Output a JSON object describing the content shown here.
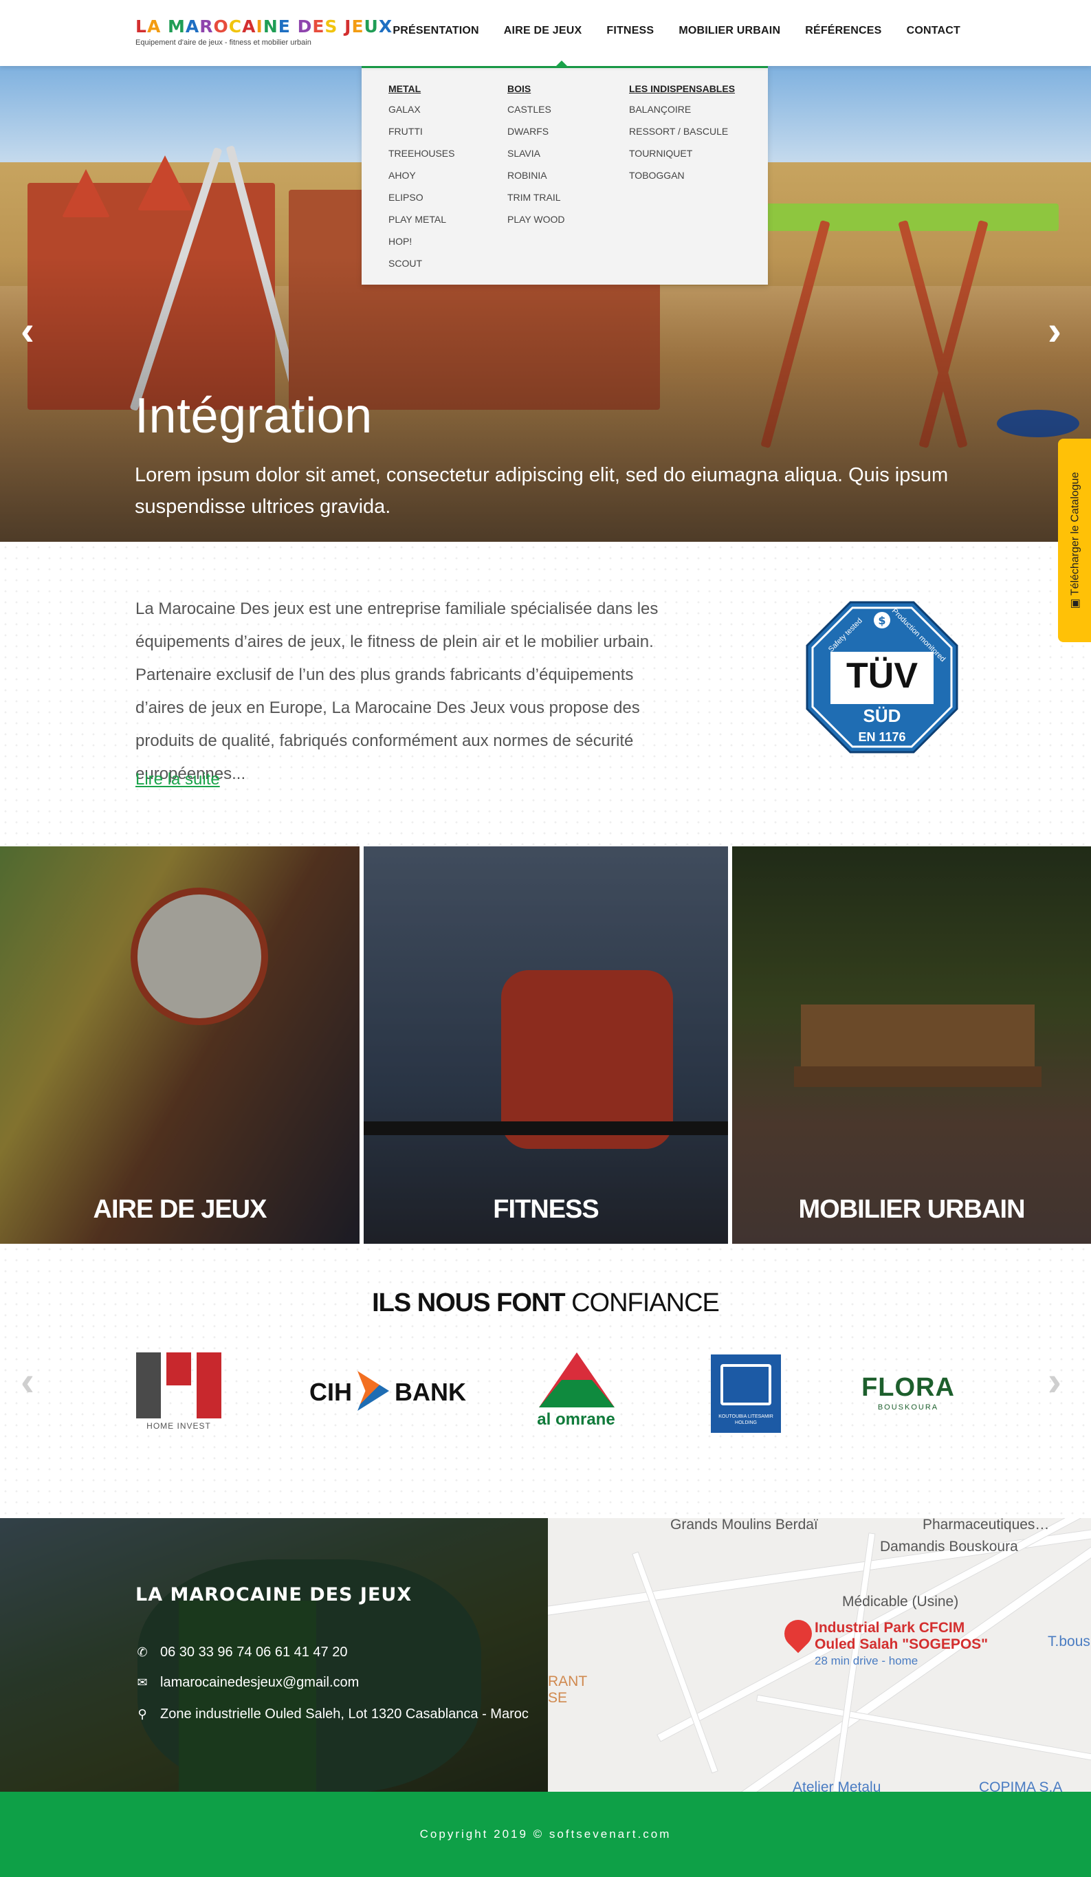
{
  "header": {
    "logo_title": "LA MAROCAINE DES JEUX",
    "logo_subtitle": "Equipement d'aire de jeux - fitness et mobilier urbain",
    "nav": [
      {
        "label": "PRÉSENTATION"
      },
      {
        "label": "AIRE DE JEUX"
      },
      {
        "label": "FITNESS"
      },
      {
        "label": "MOBILIER URBAIN"
      },
      {
        "label": "RÉFÉRENCES"
      },
      {
        "label": "CONTACT"
      }
    ]
  },
  "mega_menu": {
    "columns": [
      {
        "heading": "METAL",
        "items": [
          "GALAX",
          "FRUTTI",
          "TREEHOUSES",
          "AHOY",
          "ELIPSO",
          "PLAY METAL",
          "HOP!",
          "SCOUT"
        ]
      },
      {
        "heading": "BOIS",
        "items": [
          "CASTLES",
          "DWARFS",
          "SLAVIA",
          "ROBINIA",
          "TRIM TRAIL",
          "PLAY WOOD"
        ]
      },
      {
        "heading": "LES INDISPENSABLES",
        "items": [
          "BALANÇOIRE",
          "RESSORT / BASCULE",
          "TOURNIQUET",
          "TOBOGGAN"
        ]
      }
    ]
  },
  "hero": {
    "title": "Intégration",
    "text": "Lorem ipsum dolor sit amet, consectetur adipiscing elit, sed do eiumagna aliqua. Quis ipsum suspendisse ultrices gravida.",
    "prev_arrow": "‹",
    "next_arrow": "›"
  },
  "catalog_tab": {
    "label": "Télécharger le Catalogue",
    "icon": "pdf-icon"
  },
  "intro": {
    "text": "La Marocaine Des jeux est une entreprise familiale spécialisée dans les équipements d’aires de jeux, le fitness de plein air et le mobilier urbain. Partenaire exclusif de l’un des plus grands fabricants d’équipements d’aires de jeux en Europe, La Marocaine Des Jeux vous propose des produits de qualité, fabriqués conformément aux normes de sécurité européennes...",
    "link": "Lire la suite",
    "badge": {
      "brand": "TÜV",
      "sub": "SÜD",
      "norm": "EN 1176",
      "left_text": "Safety tested",
      "right_text": "Production monitored"
    }
  },
  "categories": [
    {
      "label": "AIRE DE JEUX"
    },
    {
      "label": "FITNESS"
    },
    {
      "label": "MOBILIER URBAIN"
    }
  ],
  "trust": {
    "title_bold": "ILS NOUS FONT",
    "title_rest": "CONFIANCE",
    "logos": [
      {
        "name": "HOME INVEST"
      },
      {
        "name_left": "CIH",
        "name_right": "BANK"
      },
      {
        "name": "al omrane"
      },
      {
        "name": "KOUTOUBIA LITESAMIR HOLDING"
      },
      {
        "name": "FLORA",
        "sub": "BOUSKOURA"
      }
    ]
  },
  "footer": {
    "title": "LA MAROCAINE DES JEUX",
    "phone": "06 30 33 96 74  06 61 41 47 20",
    "email": "lamarocainedesjeux@gmail.com",
    "address": "Zone industrielle Ouled Saleh, Lot 1320  Casablanca - Maroc"
  },
  "map": {
    "labels": {
      "grands_moulins": "Grands Moulins Berdaï",
      "pharma": "Pharmaceutiques…",
      "damandis": "Damandis Bouskoura",
      "medicable": "Médicable (Usine)",
      "pin_title": "Industrial Park CFCIM",
      "pin_title2": "Ouled Salah \"SOGEPOS\"",
      "pin_sub": "28 min drive - home",
      "tbous": "T.bous",
      "rant": "RANT",
      "se": "SE",
      "atelier": "Atelier Metalu",
      "copima": "COPIMA S.A"
    }
  },
  "copyright": "Copyright 2019 © softsevenart.com",
  "colors": {
    "accent": "#0ea047",
    "catalog": "#ffc107",
    "tuv_blue": "#1f6db3"
  }
}
